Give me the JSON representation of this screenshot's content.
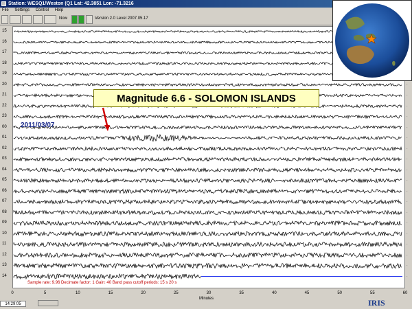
{
  "window": {
    "title": "Station: WESQ1/Weston (Q1 Lat: 42.3851 Lon: -71.3216"
  },
  "menu": [
    "File",
    "Settings",
    "Control",
    "Help"
  ],
  "toolbar": {
    "now_label": "Now",
    "version": "Version 2.0 Level 2007.05.17"
  },
  "rows": {
    "left_labels": [
      "15",
      "16",
      "17",
      "18",
      "19",
      "20",
      "21",
      "22",
      "23",
      "00",
      "01",
      "02",
      "03",
      "04",
      "05",
      "06",
      "07",
      "08",
      "09",
      "10",
      "11",
      "12",
      "13",
      "14"
    ]
  },
  "event": {
    "callout": "Magnitude 6.6 - SOLOMON ISLANDS",
    "date": "2011/03/07"
  },
  "info": {
    "sample": "Sample rate: 9.96  Decimate factor: 1  Gain: 40  Band pass cutoff periods: 15 s 20 s"
  },
  "axis": {
    "ticks": [
      "0",
      "5",
      "10",
      "15",
      "20",
      "25",
      "30",
      "35",
      "40",
      "45",
      "50",
      "55",
      "60"
    ],
    "label": "Minutes"
  },
  "status": {
    "clock": "14:29:05"
  },
  "logo": "IRIS",
  "colors": {
    "callout_bg": "#ffffc0",
    "date_text": "#1a2a8a",
    "info_text": "#c00000",
    "arrow": "#d00000",
    "flat_line": "#2233ee"
  }
}
